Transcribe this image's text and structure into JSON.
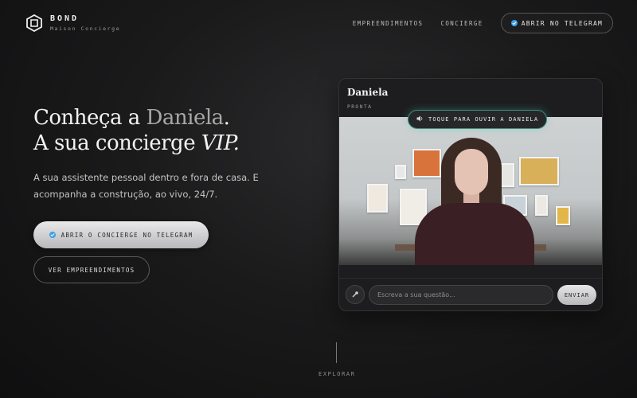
{
  "brand": {
    "name": "BOND",
    "tagline": "Maison Concierge",
    "logo_icon": "hexagon-logo-icon"
  },
  "nav": {
    "links": [
      "EMPREENDIMENTOS",
      "CONCIERGE"
    ],
    "telegram_button": "ABRIR NO TELEGRAM"
  },
  "hero": {
    "title_line1_pre": "Conheça a ",
    "title_line1_name": "Daniela",
    "title_line1_post": ".",
    "title_line2_pre": "A sua concierge ",
    "title_line2_em": "VIP.",
    "description": "A sua assistente pessoal dentro e fora de casa. E acompanha a construção, ao vivo, 24/7.",
    "primary_button": "ABRIR O CONCIERGE NO TELEGRAM",
    "secondary_button": "VER EMPREENDIMENTOS"
  },
  "card": {
    "name": "Daniela",
    "status": "PRONTA",
    "speak_prompt": "TOQUE PARA OUVIR A DANIELA",
    "input_placeholder": "Escreva a sua questão...",
    "send_label": "ENVIAR"
  },
  "footer": {
    "explore": "EXPLORAR"
  },
  "colors": {
    "accent_telegram": "#3aa0e8",
    "glow": "#3d8d7d"
  }
}
